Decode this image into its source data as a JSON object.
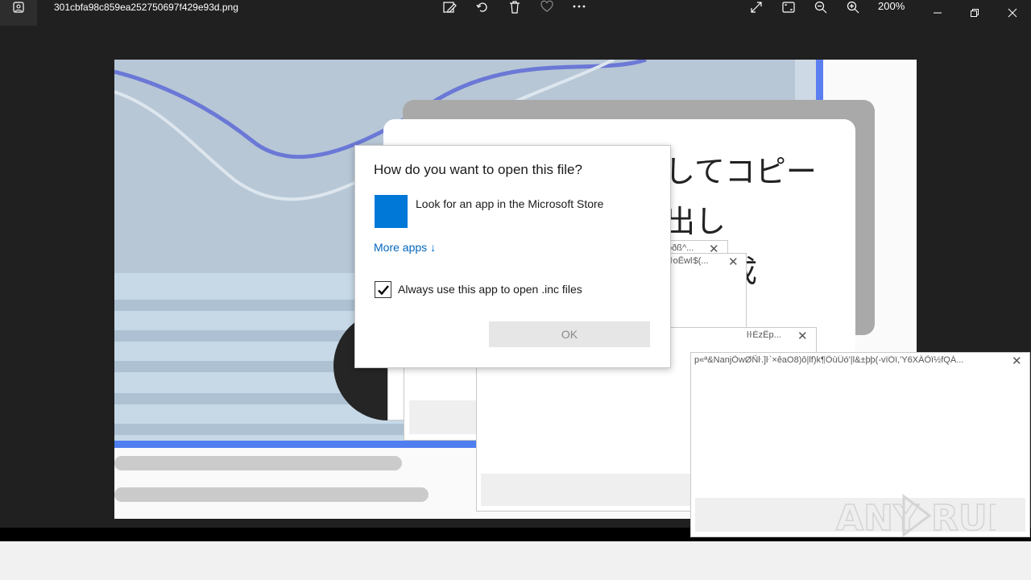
{
  "window": {
    "file_name": "301cbfa98c859ea252750697f429e93d.png",
    "zoom_level": "200%"
  },
  "toolbar": {
    "icons": [
      "edit-image-icon",
      "rotate-icon",
      "delete-icon",
      "favorite-icon",
      "more-icon"
    ],
    "view_icons": [
      "fullscreen-icon",
      "fit-window-icon",
      "zoom-out-icon",
      "zoom-in-icon"
    ]
  },
  "image_content": {
    "jp_line1": "してコピー",
    "jp_line2": "出し",
    "jp_line3": "成"
  },
  "ghost_windows": [
    {
      "title": "ôðß^..."
    },
    {
      "title": "\"ŀoÊwŀ$(..."
    },
    {
      "title": "ŀŀÉzÊp..."
    },
    {
      "title": "p«ª&NanjÕwØÑŀ.]ŀ`×êaO8)ô|lf)k¶ÔùÛó'|l&±þþ(-vïÒï,'Y6XÄÕï½fQÀ..."
    }
  ],
  "dialog": {
    "title": "How do you want to open this file?",
    "store_option": "Look for an app in the Microsoft Store",
    "more_apps": "More apps",
    "more_apps_arrow": "↓",
    "always_use": "Always use this app to open .inc files",
    "always_use_checked": true,
    "ok": "OK"
  },
  "watermark": {
    "text": "ANY RUN"
  },
  "colors": {
    "accent": "#0078d7",
    "link": "#0067c0",
    "frame_bg": "#202020"
  }
}
